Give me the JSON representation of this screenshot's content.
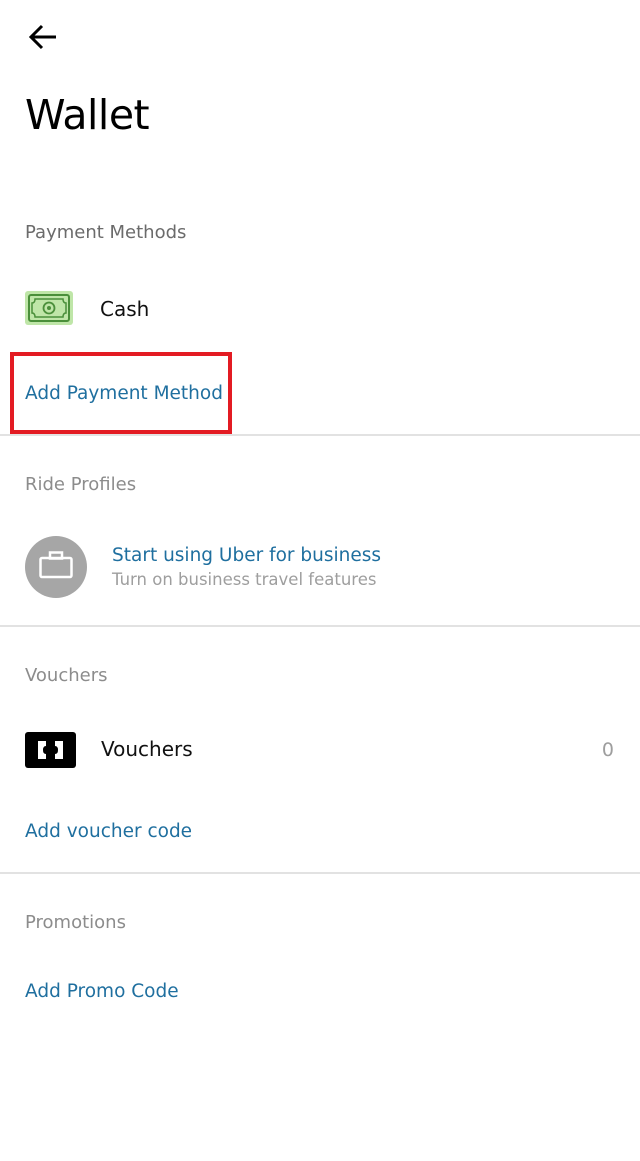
{
  "header": {
    "back_icon": "arrow-left-icon",
    "title": "Wallet"
  },
  "payment_methods": {
    "section_label": "Payment Methods",
    "items": [
      {
        "icon": "cash-icon",
        "label": "Cash"
      }
    ],
    "add_label": "Add Payment Method",
    "highlight_color": "#e31b23"
  },
  "ride_profiles": {
    "section_label": "Ride Profiles",
    "business": {
      "icon": "briefcase-icon",
      "title": "Start using Uber for business",
      "subtitle": "Turn on business travel features"
    }
  },
  "vouchers": {
    "section_label": "Vouchers",
    "row": {
      "icon": "ticket-icon",
      "label": "Vouchers",
      "count": "0"
    },
    "add_label": "Add voucher code"
  },
  "promotions": {
    "section_label": "Promotions",
    "add_label": "Add Promo Code"
  },
  "colors": {
    "link": "#1f6f9f",
    "cash_icon_bg": "#bfe6a8",
    "divider": "#e2e2e2"
  }
}
